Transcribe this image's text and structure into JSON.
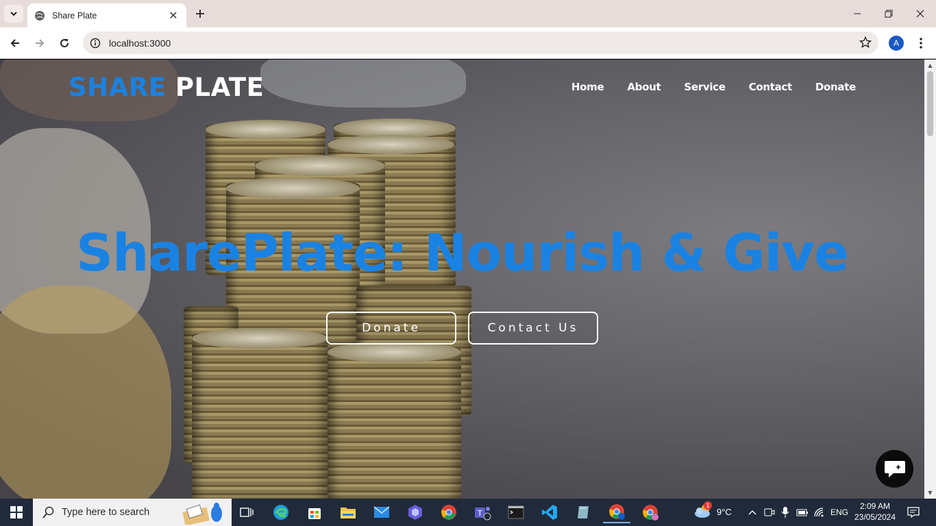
{
  "browser": {
    "tab_title": "Share Plate",
    "url": "localhost:3000",
    "profile_initial": "A"
  },
  "site": {
    "logo_part1": "SHARE",
    "logo_part2": "PLATE",
    "nav": [
      "Home",
      "About",
      "Service",
      "Contact",
      "Donate"
    ],
    "hero_title": "SharePlate: Nourish & Give",
    "buttons": {
      "donate": "Donate",
      "contact": "Contact Us"
    },
    "accent_color": "#1a82e2"
  },
  "taskbar": {
    "search_placeholder": "Type here to search",
    "weather": "9°C",
    "weather_badge": "1",
    "language": "ENG",
    "time": "2:09 AM",
    "date": "23/05/2024"
  }
}
